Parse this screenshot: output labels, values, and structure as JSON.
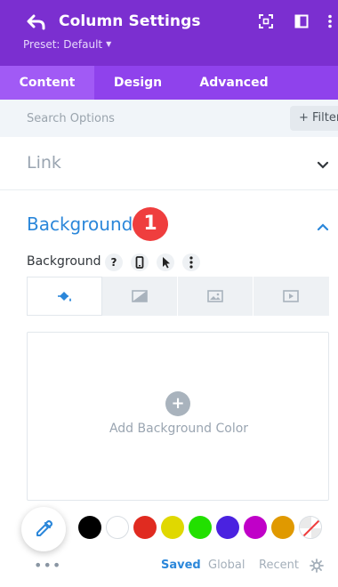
{
  "header": {
    "title": "Column Settings",
    "preset": "Preset: Default",
    "bg_color": "#7b2fd0"
  },
  "tabs": [
    {
      "label": "Content",
      "active": true
    },
    {
      "label": "Design",
      "active": false
    },
    {
      "label": "Advanced",
      "active": false
    }
  ],
  "search": {
    "placeholder": "Search Options",
    "filter_label": "+ Filter"
  },
  "sections": {
    "link": {
      "title": "Link",
      "expanded": false
    },
    "background": {
      "title": "Background",
      "expanded": true,
      "badge": "1"
    }
  },
  "background_field": {
    "label": "Background",
    "help": "?",
    "types": [
      "paint-bucket-icon",
      "gradient-icon",
      "image-icon",
      "video-icon"
    ],
    "active_type": 0,
    "add_label": "Add Background Color",
    "plus": "+"
  },
  "palette": {
    "swatches": [
      "#000000",
      "#ffffff",
      "#e02b20",
      "#e0d800",
      "#22e000",
      "#4a22e0",
      "#c000c8",
      "#e09900"
    ],
    "tabs": [
      "Saved",
      "Global",
      "Recent"
    ],
    "active_tab": "Saved",
    "more": "•••"
  },
  "colors": {
    "accent": "#2b87da",
    "tab_bg": "#8f42ec",
    "tab_active": "#a15af5",
    "badge": "#ef3e3e"
  }
}
